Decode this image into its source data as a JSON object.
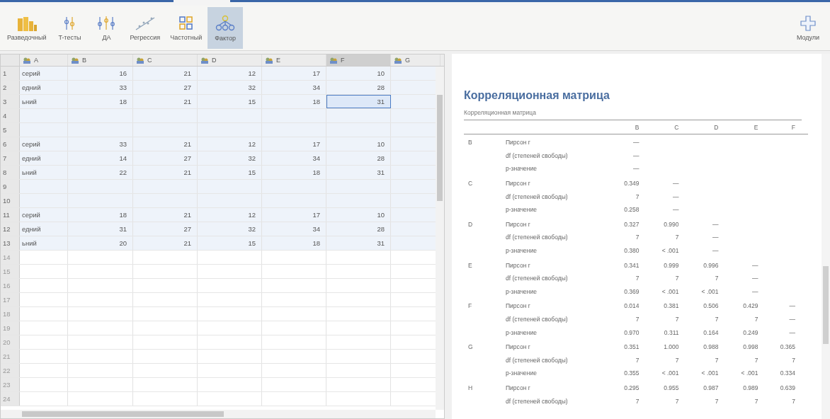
{
  "ribbon": {
    "items": [
      {
        "label": "Разведочный",
        "kind": "descriptives",
        "selected": false
      },
      {
        "label": "T-тесты",
        "kind": "ttest",
        "selected": false
      },
      {
        "label": "ДА",
        "kind": "anova",
        "selected": false
      },
      {
        "label": "Регрессия",
        "kind": "regression",
        "selected": false
      },
      {
        "label": "Частотный",
        "kind": "frequencies",
        "selected": false
      },
      {
        "label": "Фактор",
        "kind": "factor",
        "selected": true
      }
    ],
    "modules": {
      "label": "Модули"
    }
  },
  "data_grid": {
    "columns": [
      {
        "name": "A",
        "selected": false
      },
      {
        "name": "B",
        "selected": false
      },
      {
        "name": "C",
        "selected": false
      },
      {
        "name": "D",
        "selected": false
      },
      {
        "name": "E",
        "selected": false
      },
      {
        "name": "F",
        "selected": true
      },
      {
        "name": "G",
        "selected": false
      }
    ],
    "rows": [
      {
        "number": "1",
        "kind": "data",
        "cells": [
          {
            "text": "серий",
            "selected": false
          },
          {
            "text": "16",
            "selected": false
          },
          {
            "text": "21",
            "selected": false
          },
          {
            "text": "12",
            "selected": false
          },
          {
            "text": "17",
            "selected": false
          },
          {
            "text": "10",
            "selected": false
          }
        ]
      },
      {
        "number": "2",
        "kind": "data",
        "cells": [
          {
            "text": "едний",
            "selected": false
          },
          {
            "text": "33",
            "selected": false
          },
          {
            "text": "27",
            "selected": false
          },
          {
            "text": "32",
            "selected": false
          },
          {
            "text": "34",
            "selected": false
          },
          {
            "text": "28",
            "selected": false
          }
        ]
      },
      {
        "number": "3",
        "kind": "data",
        "cells": [
          {
            "text": "ьний",
            "selected": false
          },
          {
            "text": "18",
            "selected": false
          },
          {
            "text": "21",
            "selected": false
          },
          {
            "text": "15",
            "selected": false
          },
          {
            "text": "18",
            "selected": false
          },
          {
            "text": "31",
            "selected": true
          }
        ]
      },
      {
        "number": "4",
        "kind": "empty"
      },
      {
        "number": "5",
        "kind": "empty"
      },
      {
        "number": "6",
        "kind": "data",
        "cells": [
          {
            "text": "серий",
            "selected": false
          },
          {
            "text": "33",
            "selected": false
          },
          {
            "text": "21",
            "selected": false
          },
          {
            "text": "12",
            "selected": false
          },
          {
            "text": "17",
            "selected": false
          },
          {
            "text": "10",
            "selected": false
          }
        ]
      },
      {
        "number": "7",
        "kind": "data",
        "cells": [
          {
            "text": "едний",
            "selected": false
          },
          {
            "text": "14",
            "selected": false
          },
          {
            "text": "27",
            "selected": false
          },
          {
            "text": "32",
            "selected": false
          },
          {
            "text": "34",
            "selected": false
          },
          {
            "text": "28",
            "selected": false
          }
        ]
      },
      {
        "number": "8",
        "kind": "data",
        "cells": [
          {
            "text": "ьний",
            "selected": false
          },
          {
            "text": "22",
            "selected": false
          },
          {
            "text": "21",
            "selected": false
          },
          {
            "text": "15",
            "selected": false
          },
          {
            "text": "18",
            "selected": false
          },
          {
            "text": "31",
            "selected": false
          }
        ]
      },
      {
        "number": "9",
        "kind": "empty"
      },
      {
        "number": "10",
        "kind": "empty"
      },
      {
        "number": "11",
        "kind": "data",
        "cells": [
          {
            "text": "серий",
            "selected": false
          },
          {
            "text": "18",
            "selected": false
          },
          {
            "text": "21",
            "selected": false
          },
          {
            "text": "12",
            "selected": false
          },
          {
            "text": "17",
            "selected": false
          },
          {
            "text": "10",
            "selected": false
          }
        ]
      },
      {
        "number": "12",
        "kind": "data",
        "cells": [
          {
            "text": "едний",
            "selected": false
          },
          {
            "text": "31",
            "selected": false
          },
          {
            "text": "27",
            "selected": false
          },
          {
            "text": "32",
            "selected": false
          },
          {
            "text": "34",
            "selected": false
          },
          {
            "text": "28",
            "selected": false
          }
        ]
      },
      {
        "number": "13",
        "kind": "data",
        "cells": [
          {
            "text": "ьний",
            "selected": false
          },
          {
            "text": "20",
            "selected": false
          },
          {
            "text": "21",
            "selected": false
          },
          {
            "text": "15",
            "selected": false
          },
          {
            "text": "18",
            "selected": false
          },
          {
            "text": "31",
            "selected": false
          }
        ]
      },
      {
        "number": "14",
        "kind": "unused"
      },
      {
        "number": "15",
        "kind": "unused"
      },
      {
        "number": "16",
        "kind": "unused"
      },
      {
        "number": "17",
        "kind": "unused"
      },
      {
        "number": "18",
        "kind": "unused"
      },
      {
        "number": "19",
        "kind": "unused"
      },
      {
        "number": "20",
        "kind": "unused"
      },
      {
        "number": "21",
        "kind": "unused"
      },
      {
        "number": "22",
        "kind": "unused"
      },
      {
        "number": "23",
        "kind": "unused"
      },
      {
        "number": "24",
        "kind": "unused"
      }
    ]
  },
  "results": {
    "title": "Корреляционная матрица",
    "table": {
      "caption": "Корреляционная матрица",
      "columns": [
        "B",
        "C",
        "D",
        "E",
        "F"
      ],
      "groups": [
        {
          "variable": "B",
          "stats": [
            {
              "label": "Пирсон r",
              "values": [
                "—"
              ]
            },
            {
              "label": "df (степеней свободы)",
              "values": [
                "—"
              ]
            },
            {
              "label": "p-значение",
              "values": [
                "—"
              ]
            }
          ]
        },
        {
          "variable": "C",
          "stats": [
            {
              "label": "Пирсон r",
              "values": [
                "0.349",
                "—"
              ]
            },
            {
              "label": "df (степеней свободы)",
              "values": [
                "7",
                "—"
              ]
            },
            {
              "label": "p-значение",
              "values": [
                "0.258",
                "—"
              ]
            }
          ]
        },
        {
          "variable": "D",
          "stats": [
            {
              "label": "Пирсон r",
              "values": [
                "0.327",
                "0.990",
                "—"
              ]
            },
            {
              "label": "df (степеней свободы)",
              "values": [
                "7",
                "7",
                "—"
              ]
            },
            {
              "label": "p-значение",
              "values": [
                "0.380",
                "< .001",
                "—"
              ]
            }
          ]
        },
        {
          "variable": "E",
          "stats": [
            {
              "label": "Пирсон r",
              "values": [
                "0.341",
                "0.999",
                "0.996",
                "—"
              ]
            },
            {
              "label": "df (степеней свободы)",
              "values": [
                "7",
                "7",
                "7",
                "—"
              ]
            },
            {
              "label": "p-значение",
              "values": [
                "0.369",
                "< .001",
                "< .001",
                "—"
              ]
            }
          ]
        },
        {
          "variable": "F",
          "stats": [
            {
              "label": "Пирсон r",
              "values": [
                "0.014",
                "0.381",
                "0.506",
                "0.429",
                "—"
              ]
            },
            {
              "label": "df (степеней свободы)",
              "values": [
                "7",
                "7",
                "7",
                "7",
                "—"
              ]
            },
            {
              "label": "p-значение",
              "values": [
                "0.970",
                "0.311",
                "0.164",
                "0.249",
                "—"
              ]
            }
          ]
        },
        {
          "variable": "G",
          "stats": [
            {
              "label": "Пирсон r",
              "values": [
                "0.351",
                "1.000",
                "0.988",
                "0.998",
                "0.365"
              ]
            },
            {
              "label": "df (степеней свободы)",
              "values": [
                "7",
                "7",
                "7",
                "7",
                "7"
              ]
            },
            {
              "label": "p-значение",
              "values": [
                "0.355",
                "< .001",
                "< .001",
                "< .001",
                "0.334"
              ]
            }
          ]
        },
        {
          "variable": "H",
          "stats": [
            {
              "label": "Пирсон r",
              "values": [
                "0.295",
                "0.955",
                "0.987",
                "0.989",
                "0.639"
              ]
            },
            {
              "label": "df (степеней свободы)",
              "values": [
                "7",
                "7",
                "7",
                "7",
                "7"
              ]
            }
          ]
        }
      ]
    }
  }
}
